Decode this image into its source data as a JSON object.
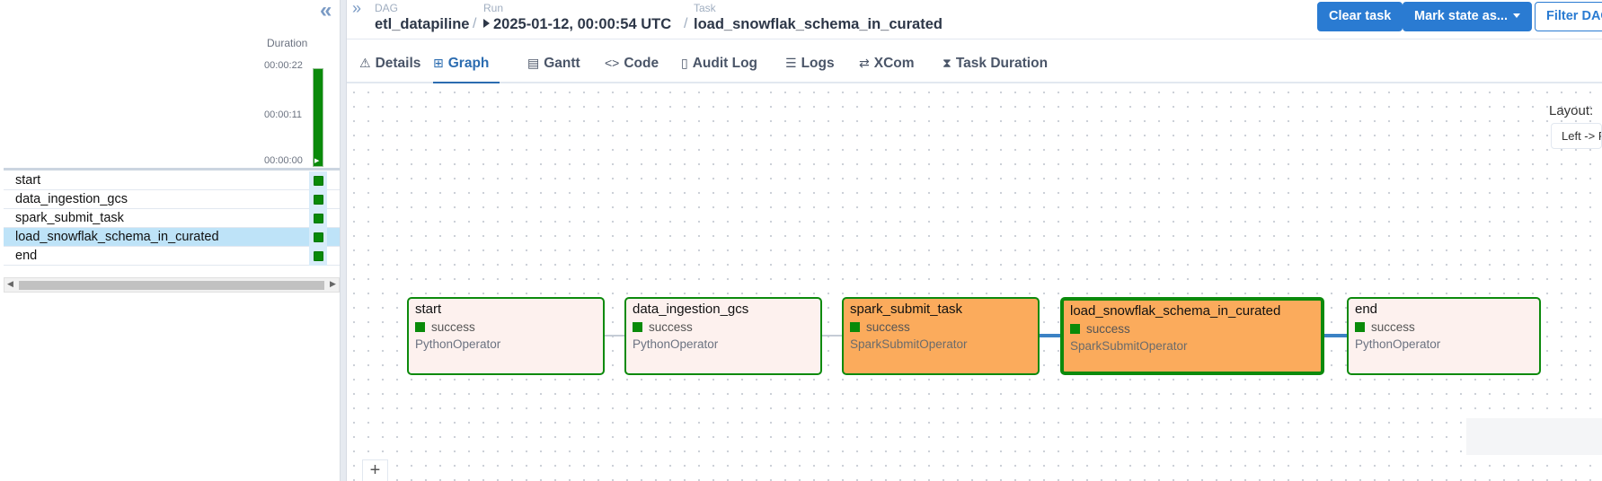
{
  "left_panel": {
    "duration_label": "Duration",
    "duration_ticks": [
      "00:00:22",
      "00:00:11",
      "00:00:00"
    ],
    "tasks": [
      {
        "name": "start",
        "state": "success"
      },
      {
        "name": "data_ingestion_gcs",
        "state": "success"
      },
      {
        "name": "spark_submit_task",
        "state": "success"
      },
      {
        "name": "load_snowflak_schema_in_curated",
        "state": "success",
        "selected": true
      },
      {
        "name": "end",
        "state": "success"
      }
    ]
  },
  "breadcrumb": {
    "dag_label": "DAG",
    "dag_value": "etl_datapiline",
    "run_label": "Run",
    "run_value": "2025-01-12, 00:00:54 UTC",
    "task_label": "Task",
    "task_value": "load_snowflak_schema_in_curated"
  },
  "actions": {
    "clear_task": "Clear task",
    "mark_state": "Mark state as...",
    "filter_dag": "Filter DAG"
  },
  "tabs": [
    {
      "label": "Details",
      "icon": "warning-triangle-icon"
    },
    {
      "label": "Graph",
      "icon": "graph-icon",
      "active": true
    },
    {
      "label": "Gantt",
      "icon": "gantt-icon"
    },
    {
      "label": "Code",
      "icon": "code-icon"
    },
    {
      "label": "Audit Log",
      "icon": "file-search-icon"
    },
    {
      "label": "Logs",
      "icon": "list-icon"
    },
    {
      "label": "XCom",
      "icon": "swap-arrows-icon"
    },
    {
      "label": "Task Duration",
      "icon": "hourglass-icon"
    }
  ],
  "graph": {
    "layout_label": "Layout:",
    "layout_value": "Left -> Right",
    "nodes": [
      {
        "name": "start",
        "status": "success",
        "operator": "PythonOperator"
      },
      {
        "name": "data_ingestion_gcs",
        "status": "success",
        "operator": "PythonOperator"
      },
      {
        "name": "spark_submit_task",
        "status": "success",
        "operator": "SparkSubmitOperator"
      },
      {
        "name": "load_snowflak_schema_in_curated",
        "status": "success",
        "operator": "SparkSubmitOperator"
      },
      {
        "name": "end",
        "status": "success",
        "operator": "PythonOperator"
      }
    ],
    "zoom_in": "+"
  },
  "colors": {
    "success": "#098a09",
    "primary": "#2a7bd2",
    "node_bg": "#fdf1ee",
    "node_highlight": "#fbab5c",
    "edge_highlight": "#3b82c4"
  }
}
